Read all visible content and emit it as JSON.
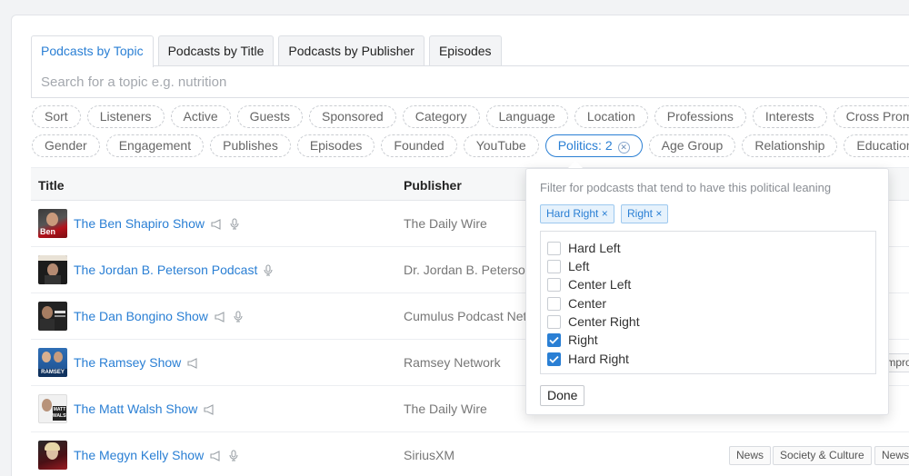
{
  "tabs": [
    "Podcasts by Topic",
    "Podcasts by Title",
    "Podcasts by Publisher",
    "Episodes"
  ],
  "search": {
    "placeholder": "Search for a topic e.g. nutrition"
  },
  "filters_row1": [
    "Sort",
    "Listeners",
    "Active",
    "Guests",
    "Sponsored",
    "Category",
    "Language",
    "Location",
    "Professions",
    "Interests",
    "Cross Promos"
  ],
  "filters_row2": [
    "Gender",
    "Engagement",
    "Publishes",
    "Episodes",
    "Founded",
    "YouTube",
    "Politics: 2",
    "Age Group",
    "Relationship",
    "Education"
  ],
  "table": {
    "headers": {
      "title": "Title",
      "publisher": "Publisher"
    },
    "rows": [
      {
        "title": "The Ben Shapiro Show",
        "publisher": "The Daily Wire",
        "icons": [
          "megaphone-icon",
          "microphone-icon"
        ]
      },
      {
        "title": "The Jordan B. Peterson Podcast",
        "publisher": "Dr. Jordan B. Peterson",
        "icons": [
          "microphone-icon"
        ]
      },
      {
        "title": "The Dan Bongino Show",
        "publisher": "Cumulus Podcast Netw",
        "icons": [
          "megaphone-icon",
          "microphone-icon"
        ]
      },
      {
        "title": "The Ramsey Show",
        "publisher": "Ramsey Network",
        "icons": [
          "megaphone-icon"
        ],
        "partial_tag": "Impro"
      },
      {
        "title": "The Matt Walsh Show",
        "publisher": "The Daily Wire",
        "icons": [
          "megaphone-icon"
        ]
      },
      {
        "title": "The Megyn Kelly Show",
        "publisher": "SiriusXM",
        "icons": [
          "megaphone-icon",
          "microphone-icon"
        ],
        "tags": [
          "News",
          "Society & Culture",
          "News"
        ]
      }
    ]
  },
  "politics_popover": {
    "description": "Filter for podcasts that tend to have this political leaning",
    "selected": [
      "Hard Right ×",
      "Right ×"
    ],
    "options": [
      {
        "label": "Hard Left",
        "checked": false
      },
      {
        "label": "Left",
        "checked": false
      },
      {
        "label": "Center Left",
        "checked": false
      },
      {
        "label": "Center",
        "checked": false
      },
      {
        "label": "Center Right",
        "checked": false
      },
      {
        "label": "Right",
        "checked": true
      },
      {
        "label": "Hard Right",
        "checked": true
      }
    ],
    "done_label": "Done"
  },
  "colors": {
    "accent": "#2a7fd4",
    "selected_bg": "#e6f2fc"
  }
}
